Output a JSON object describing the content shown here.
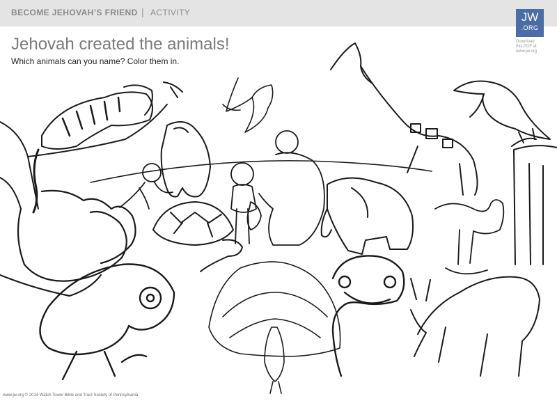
{
  "header": {
    "series": "BECOME JEHOVAH’S FRIEND",
    "separator": "|",
    "kind": "ACTIVITY"
  },
  "logo": {
    "line1": "JW",
    "line2": ".ORG",
    "download_note_1": "Download",
    "download_note_2": "this PDF at",
    "download_note_3": "www.jw.org"
  },
  "main": {
    "title": "Jehovah created the animals!",
    "instructions": "Which animals can you name? Color them in."
  },
  "illustration": {
    "icon": "coloring-page-illustration-icon"
  },
  "footer": {
    "copyright": "www.jw.org © 2014 Watch Tower Bible and Tract Society of Pennsylvania"
  }
}
